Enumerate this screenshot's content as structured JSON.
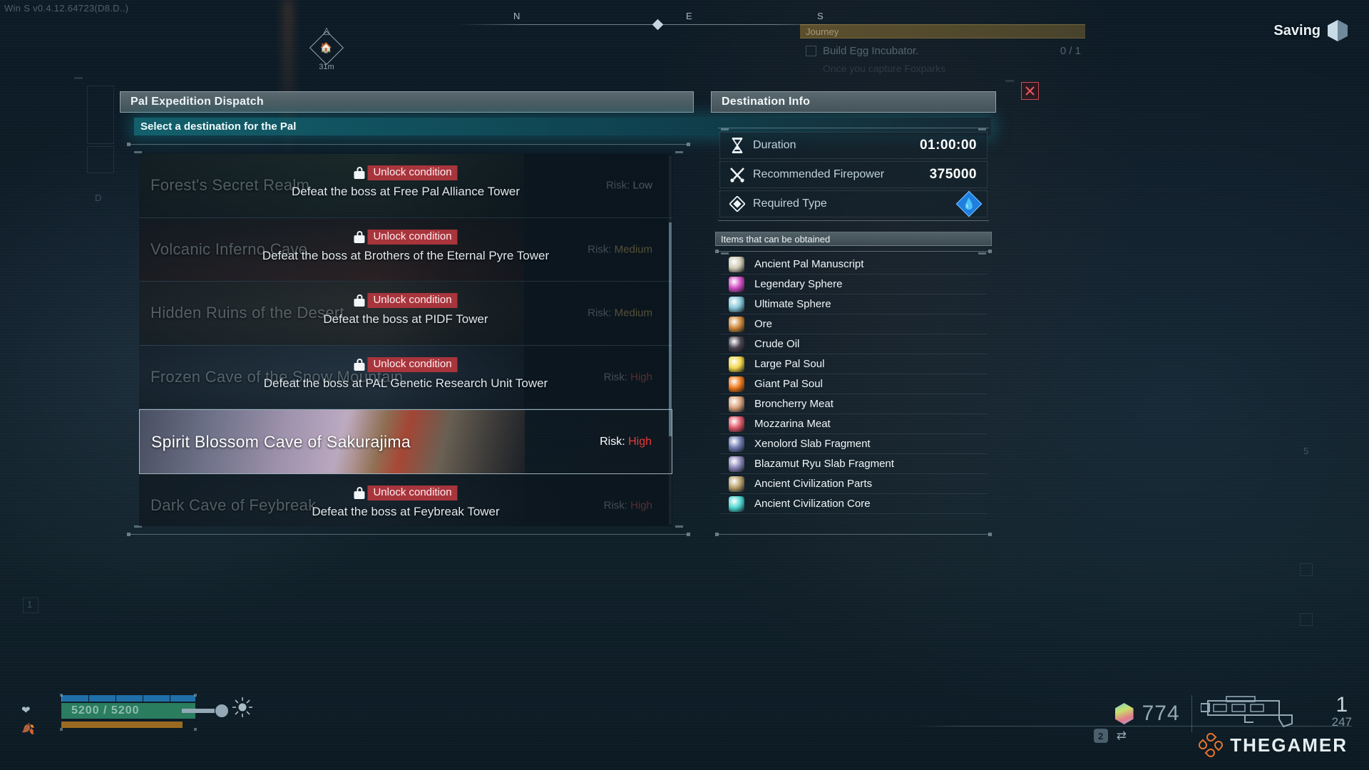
{
  "hud": {
    "version_text": "Win S v0.4.12.64723(D8.D..)",
    "compass": {
      "marks": [
        "N",
        "E",
        "S"
      ],
      "waypoint_distance": "31m",
      "waypoint_icon": "home-marker-icon"
    },
    "saving": {
      "label": "Saving",
      "icon": "saving-spinner-icon"
    },
    "quest": {
      "title": "Journey",
      "objective": "Build Egg Incubator.",
      "progress": "0 / 1",
      "subtext": "Once you capture Foxparks"
    },
    "player": {
      "hp_text": "5200 / 5200",
      "pal_count": "774",
      "ammo_current": "1",
      "ammo_reserve": "247",
      "key_hint": "2",
      "swap_icon": "swap-icon"
    },
    "watermark": "THEGAMER"
  },
  "dialog": {
    "left_panel_title": "Pal Expedition Dispatch",
    "subtitle": "Select a destination for the Pal",
    "close_label": "close-button",
    "risk_prefix": "Risk:",
    "unlock_badge": "Unlock condition",
    "destinations": [
      {
        "name": "Forest's Secret Realm",
        "risk": "Low",
        "risk_color": "#9fb2bd",
        "locked": true,
        "unlock_desc": "Defeat the boss at Free Pal Alliance Tower",
        "thumb": "forest"
      },
      {
        "name": "Volcanic Inferno Cave",
        "risk": "Medium",
        "risk_color": "#b9a15a",
        "locked": true,
        "unlock_desc": "Defeat the boss at Brothers of the Eternal Pyre Tower",
        "thumb": "volcano"
      },
      {
        "name": "Hidden Ruins of the Desert",
        "risk": "Medium",
        "risk_color": "#b9a15a",
        "locked": true,
        "unlock_desc": "Defeat the boss at PIDF Tower",
        "thumb": "desert"
      },
      {
        "name": "Frozen Cave of the Snow Mountain",
        "risk": "High",
        "risk_color": "#c05050",
        "locked": true,
        "unlock_desc": "Defeat the boss at PAL Genetic Research Unit Tower",
        "thumb": "snow"
      },
      {
        "name": "Spirit Blossom Cave of Sakurajima",
        "risk": "High",
        "risk_color": "#e63b3b",
        "locked": false,
        "unlock_desc": "",
        "thumb": "sakura",
        "selected": true
      },
      {
        "name": "Dark Cave of Feybreak",
        "risk": "High",
        "risk_color": "#c05050",
        "locked": true,
        "unlock_desc": "Defeat the boss at Feybreak Tower",
        "thumb": "dark"
      }
    ]
  },
  "destination_info": {
    "panel_title": "Destination Info",
    "rows": [
      {
        "icon": "hourglass-icon",
        "label": "Duration",
        "value": "01:00:00"
      },
      {
        "icon": "crossed-swords-icon",
        "label": "Recommended Firepower",
        "value": "375000"
      },
      {
        "icon": "element-diamond-icon",
        "label": "Required Type",
        "value": "",
        "badge": "water-type-icon",
        "badge_color": "#1f7fe0"
      }
    ],
    "items_header": "Items that can be obtained",
    "items": [
      {
        "name": "Ancient Pal Manuscript",
        "color": "#cfcab4"
      },
      {
        "name": "Legendary Sphere",
        "color": "#d14fc4"
      },
      {
        "name": "Ultimate Sphere",
        "color": "#86c6d8"
      },
      {
        "name": "Ore",
        "color": "#d08a3c"
      },
      {
        "name": "Crude Oil",
        "color": "#4a4450"
      },
      {
        "name": "Large Pal Soul",
        "color": "#f2d64a"
      },
      {
        "name": "Giant Pal Soul",
        "color": "#f07a1e"
      },
      {
        "name": "Broncherry Meat",
        "color": "#d8a07a"
      },
      {
        "name": "Mozzarina Meat",
        "color": "#e05a6a"
      },
      {
        "name": "Xenolord Slab Fragment",
        "color": "#6f7ab0"
      },
      {
        "name": "Blazamut Ryu Slab Fragment",
        "color": "#8a86b8"
      },
      {
        "name": "Ancient Civilization Parts",
        "color": "#b9a06a"
      },
      {
        "name": "Ancient Civilization Core",
        "color": "#4fd6d0"
      }
    ]
  }
}
